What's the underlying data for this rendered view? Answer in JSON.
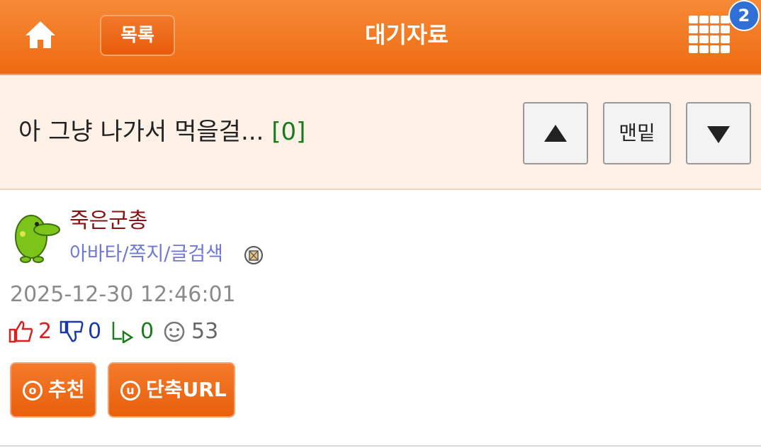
{
  "header": {
    "home_icon": "home-icon",
    "list_label": "목록",
    "title": "대기자료",
    "menu_icon": "grid-menu-icon",
    "notification_count": "2",
    "header_color": "#f07418"
  },
  "post": {
    "title": "아 그냥 나가서 먹을걸...",
    "comment_count": "[0]",
    "nav": {
      "up_icon": "arrow-up-icon",
      "bottom_label": "맨밑",
      "down_icon": "arrow-down-icon"
    },
    "author": {
      "name": "죽은군총",
      "links": "아바타/쪽지/글검색",
      "avatar_icon": "green-creature-avatar",
      "mail_icon": "mail-icon"
    },
    "date": "2025-12-30 12:46:01",
    "stats": {
      "likes": "2",
      "dislikes": "0",
      "shares": "0",
      "views": "53"
    },
    "actions": {
      "recommend_label": "추천",
      "recommend_glyph": "o",
      "shorturl_label": "단축URL",
      "shorturl_glyph": "u"
    }
  }
}
